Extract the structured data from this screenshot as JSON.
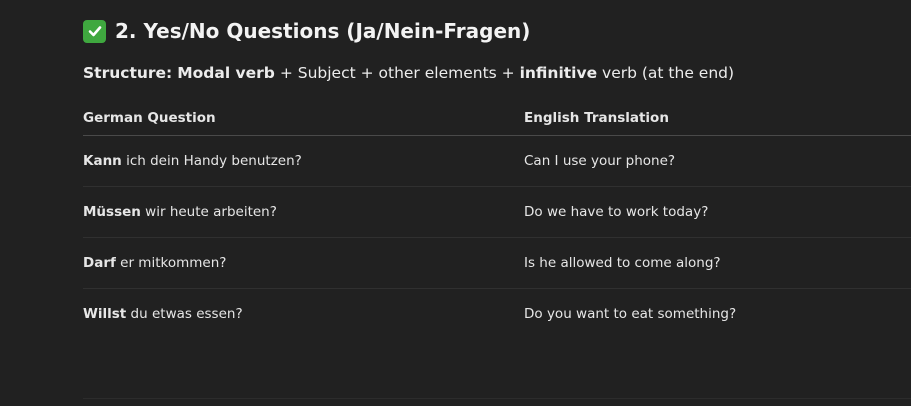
{
  "section": {
    "number_title": "2. Yes/No Questions (Ja/Nein-Fragen)"
  },
  "structure": {
    "label": "Structure:",
    "part1_bold": "Modal verb",
    "part2": " + Subject + other elements + ",
    "part3_bold": "infinitive",
    "part4": " verb (at the end)"
  },
  "table": {
    "headers": [
      "German Question",
      "English Translation"
    ],
    "rows": [
      {
        "modal": "Kann",
        "rest": " ich dein Handy benutzen?",
        "english": "Can I use your phone?"
      },
      {
        "modal": "Müssen",
        "rest": " wir heute arbeiten?",
        "english": "Do we have to work today?"
      },
      {
        "modal": "Darf",
        "rest": " er mitkommen?",
        "english": "Is he allowed to come along?"
      },
      {
        "modal": "Willst",
        "rest": " du etwas essen?",
        "english": "Do you want to eat something?"
      }
    ]
  },
  "icons": {
    "heading_icon": "check-mark-button-icon",
    "heading_icon_color": "#3fa83f"
  }
}
